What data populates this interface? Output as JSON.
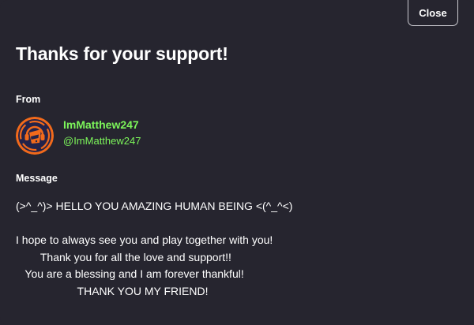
{
  "modal": {
    "title": "Thanks for your support!",
    "close_label": "Close"
  },
  "from": {
    "label": "From",
    "name": "ImMatthew247",
    "handle": "@ImMatthew247",
    "avatar_icon": "avatar-icon"
  },
  "message": {
    "label": "Message",
    "body": "(>^_^)> HELLO YOU AMAZING HUMAN BEING <(^_^<)\n\nI hope to always see you and play together with you!\n        Thank you for all the love and support!!\n   You are a blessing and I am forever thankful!\n                    THANK YOU MY FRIEND!"
  },
  "colors": {
    "background": "#26252f",
    "accent_green": "#7cf55a",
    "avatar_orange": "#f26a1b",
    "avatar_navy": "#23234a"
  }
}
